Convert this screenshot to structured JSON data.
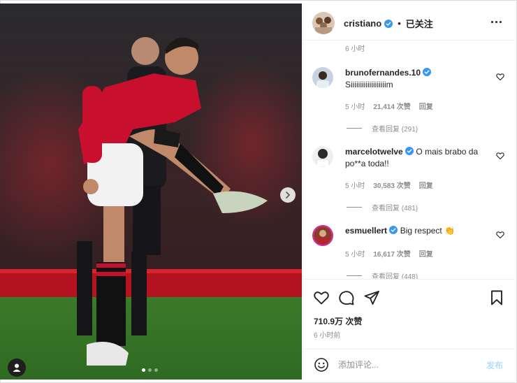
{
  "header": {
    "username": "cristiano",
    "separator": "•",
    "follow_status": "已关注"
  },
  "comments_section": {
    "top_time": "6 小时",
    "items": [
      {
        "username": "brunofernandes.10",
        "text": "Siiiiiiiiiiiiiiiiiiim",
        "time": "5 小时",
        "likes": "21,414 次赞",
        "reply": "回复",
        "view_replies": "查看回复 (291)",
        "avatar_color": "#c7d3e0"
      },
      {
        "username": "marcelotwelve",
        "text": "O mais brabo da po**a toda!!",
        "time": "5 小时",
        "likes": "30,583 次赞",
        "reply": "回复",
        "view_replies": "查看回复 (481)",
        "avatar_color": "#2b2b2b"
      },
      {
        "username": "esmuellert",
        "text": "Big respect 👏",
        "time": "5 小时",
        "likes": "16,617 次赞",
        "reply": "回复",
        "view_replies": "查看回复 (448)",
        "avatar_color": "#8a3b2d"
      }
    ]
  },
  "actions": {
    "like_icon": "heart-outline-icon",
    "comment_icon": "speech-bubble-icon",
    "share_icon": "paper-plane-icon",
    "save_icon": "bookmark-icon",
    "likes_count": "710.9万 次赞",
    "post_time": "6 小时前"
  },
  "composer": {
    "placeholder": "添加评论...",
    "value": "",
    "post_label": "发布"
  },
  "media": {
    "carousel_total": 3,
    "carousel_active": 1
  },
  "colors": {
    "verified_blue": "#3897f0",
    "post_button_disabled": "#b2dffc",
    "secondary_text": "#8e8e8e",
    "jersey_red": "#c8102e"
  }
}
